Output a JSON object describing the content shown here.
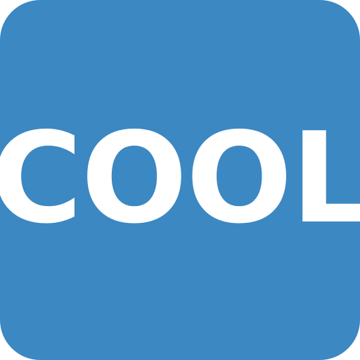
{
  "emoji": {
    "text": "COOL",
    "background_color": "#3b88c3",
    "text_color": "#ffffff"
  }
}
